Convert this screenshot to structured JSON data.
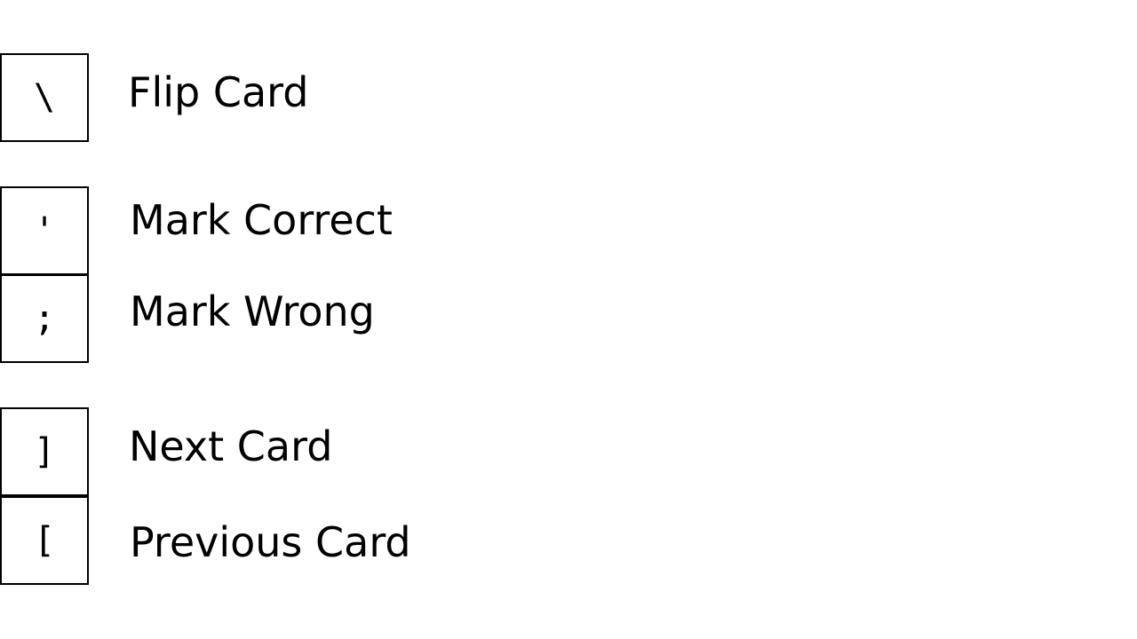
{
  "shortcuts": [
    {
      "key": "\\",
      "action": "Flip Card"
    },
    {
      "key": "'",
      "action": "Mark Correct"
    },
    {
      "key": ";",
      "action": "Mark Wrong"
    },
    {
      "key": "]",
      "action": "Next Card"
    },
    {
      "key": "[",
      "action": "Previous Card"
    }
  ]
}
